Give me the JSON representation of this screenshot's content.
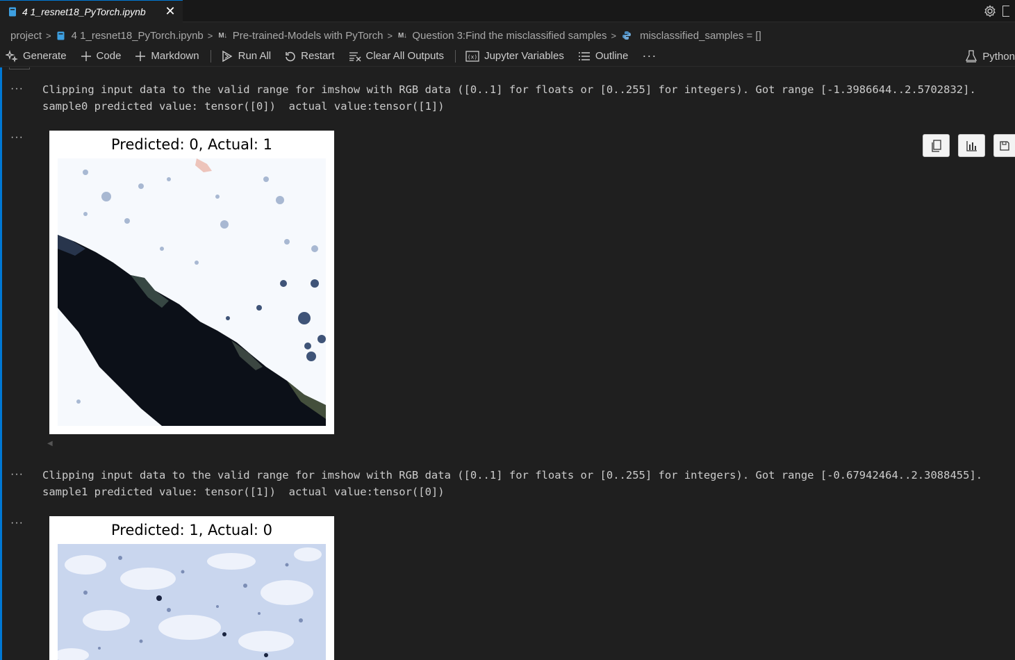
{
  "tab": {
    "title": "4 1_resnet18_PyTorch.ipynb"
  },
  "breadcrumb": {
    "project": "project",
    "notebook": "4 1_resnet18_PyTorch.ipynb",
    "md_badge": "M↓",
    "section1": "Pre-trained-Models with PyTorch",
    "section2": "Question 3:Find the misclassified samples",
    "symbol": "misclassified_samples = []"
  },
  "toolbar": {
    "generate": "Generate",
    "code": "Code",
    "markdown": "Markdown",
    "run_all": "Run All",
    "restart": "Restart",
    "clear_outputs": "Clear All Outputs",
    "variables": "Jupyter Variables",
    "outline": "Outline",
    "more": "···",
    "kernel": "Python"
  },
  "outputs": [
    {
      "warning": "Clipping input data to the valid range for imshow with RGB data ([0..1] for floats or [0..255] for integers). Got range [-1.3986644..2.5702832].",
      "result": "sample0 predicted value: tensor([0])  actual value:tensor([1])",
      "figure_title": "Predicted: 0, Actual: 1"
    },
    {
      "warning": "Clipping input data to the valid range for imshow with RGB data ([0..1] for floats or [0..255] for integers). Got range [-0.67942464..2.3088455].",
      "result": "sample1 predicted value: tensor([1])  actual value:tensor([0])",
      "figure_title": "Predicted: 1, Actual: 0"
    }
  ],
  "ellipsis": "···",
  "colors": {
    "accent": "#0078d4",
    "background": "#1f1f1f",
    "tabbar": "#181818"
  }
}
